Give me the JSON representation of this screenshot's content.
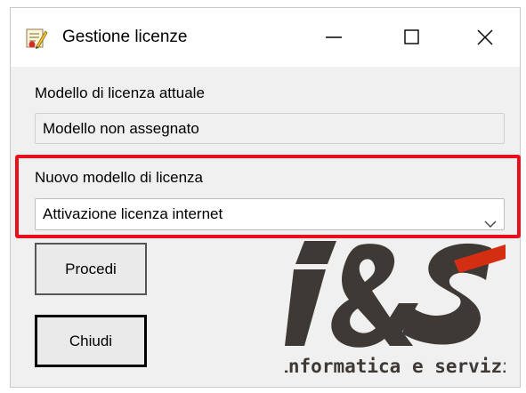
{
  "window": {
    "title": "Gestione licenze",
    "icons": {
      "app": "license-edit-icon",
      "minimize": "minimize-icon",
      "maximize": "maximize-icon",
      "close": "close-icon"
    }
  },
  "current_license": {
    "label": "Modello di licenza attuale",
    "value": "Modello non assegnato"
  },
  "new_license": {
    "label": "Nuovo modello di licenza",
    "selected": "Attivazione licenza internet",
    "icon": "chevron-down-icon"
  },
  "buttons": {
    "proceed": "Procedi",
    "close": "Chiudi"
  },
  "logo": {
    "tagline": "informatica e servizi"
  },
  "colors": {
    "highlight": "#e8111b",
    "logo_dark": "#3e3935",
    "logo_accent": "#d42e12"
  }
}
